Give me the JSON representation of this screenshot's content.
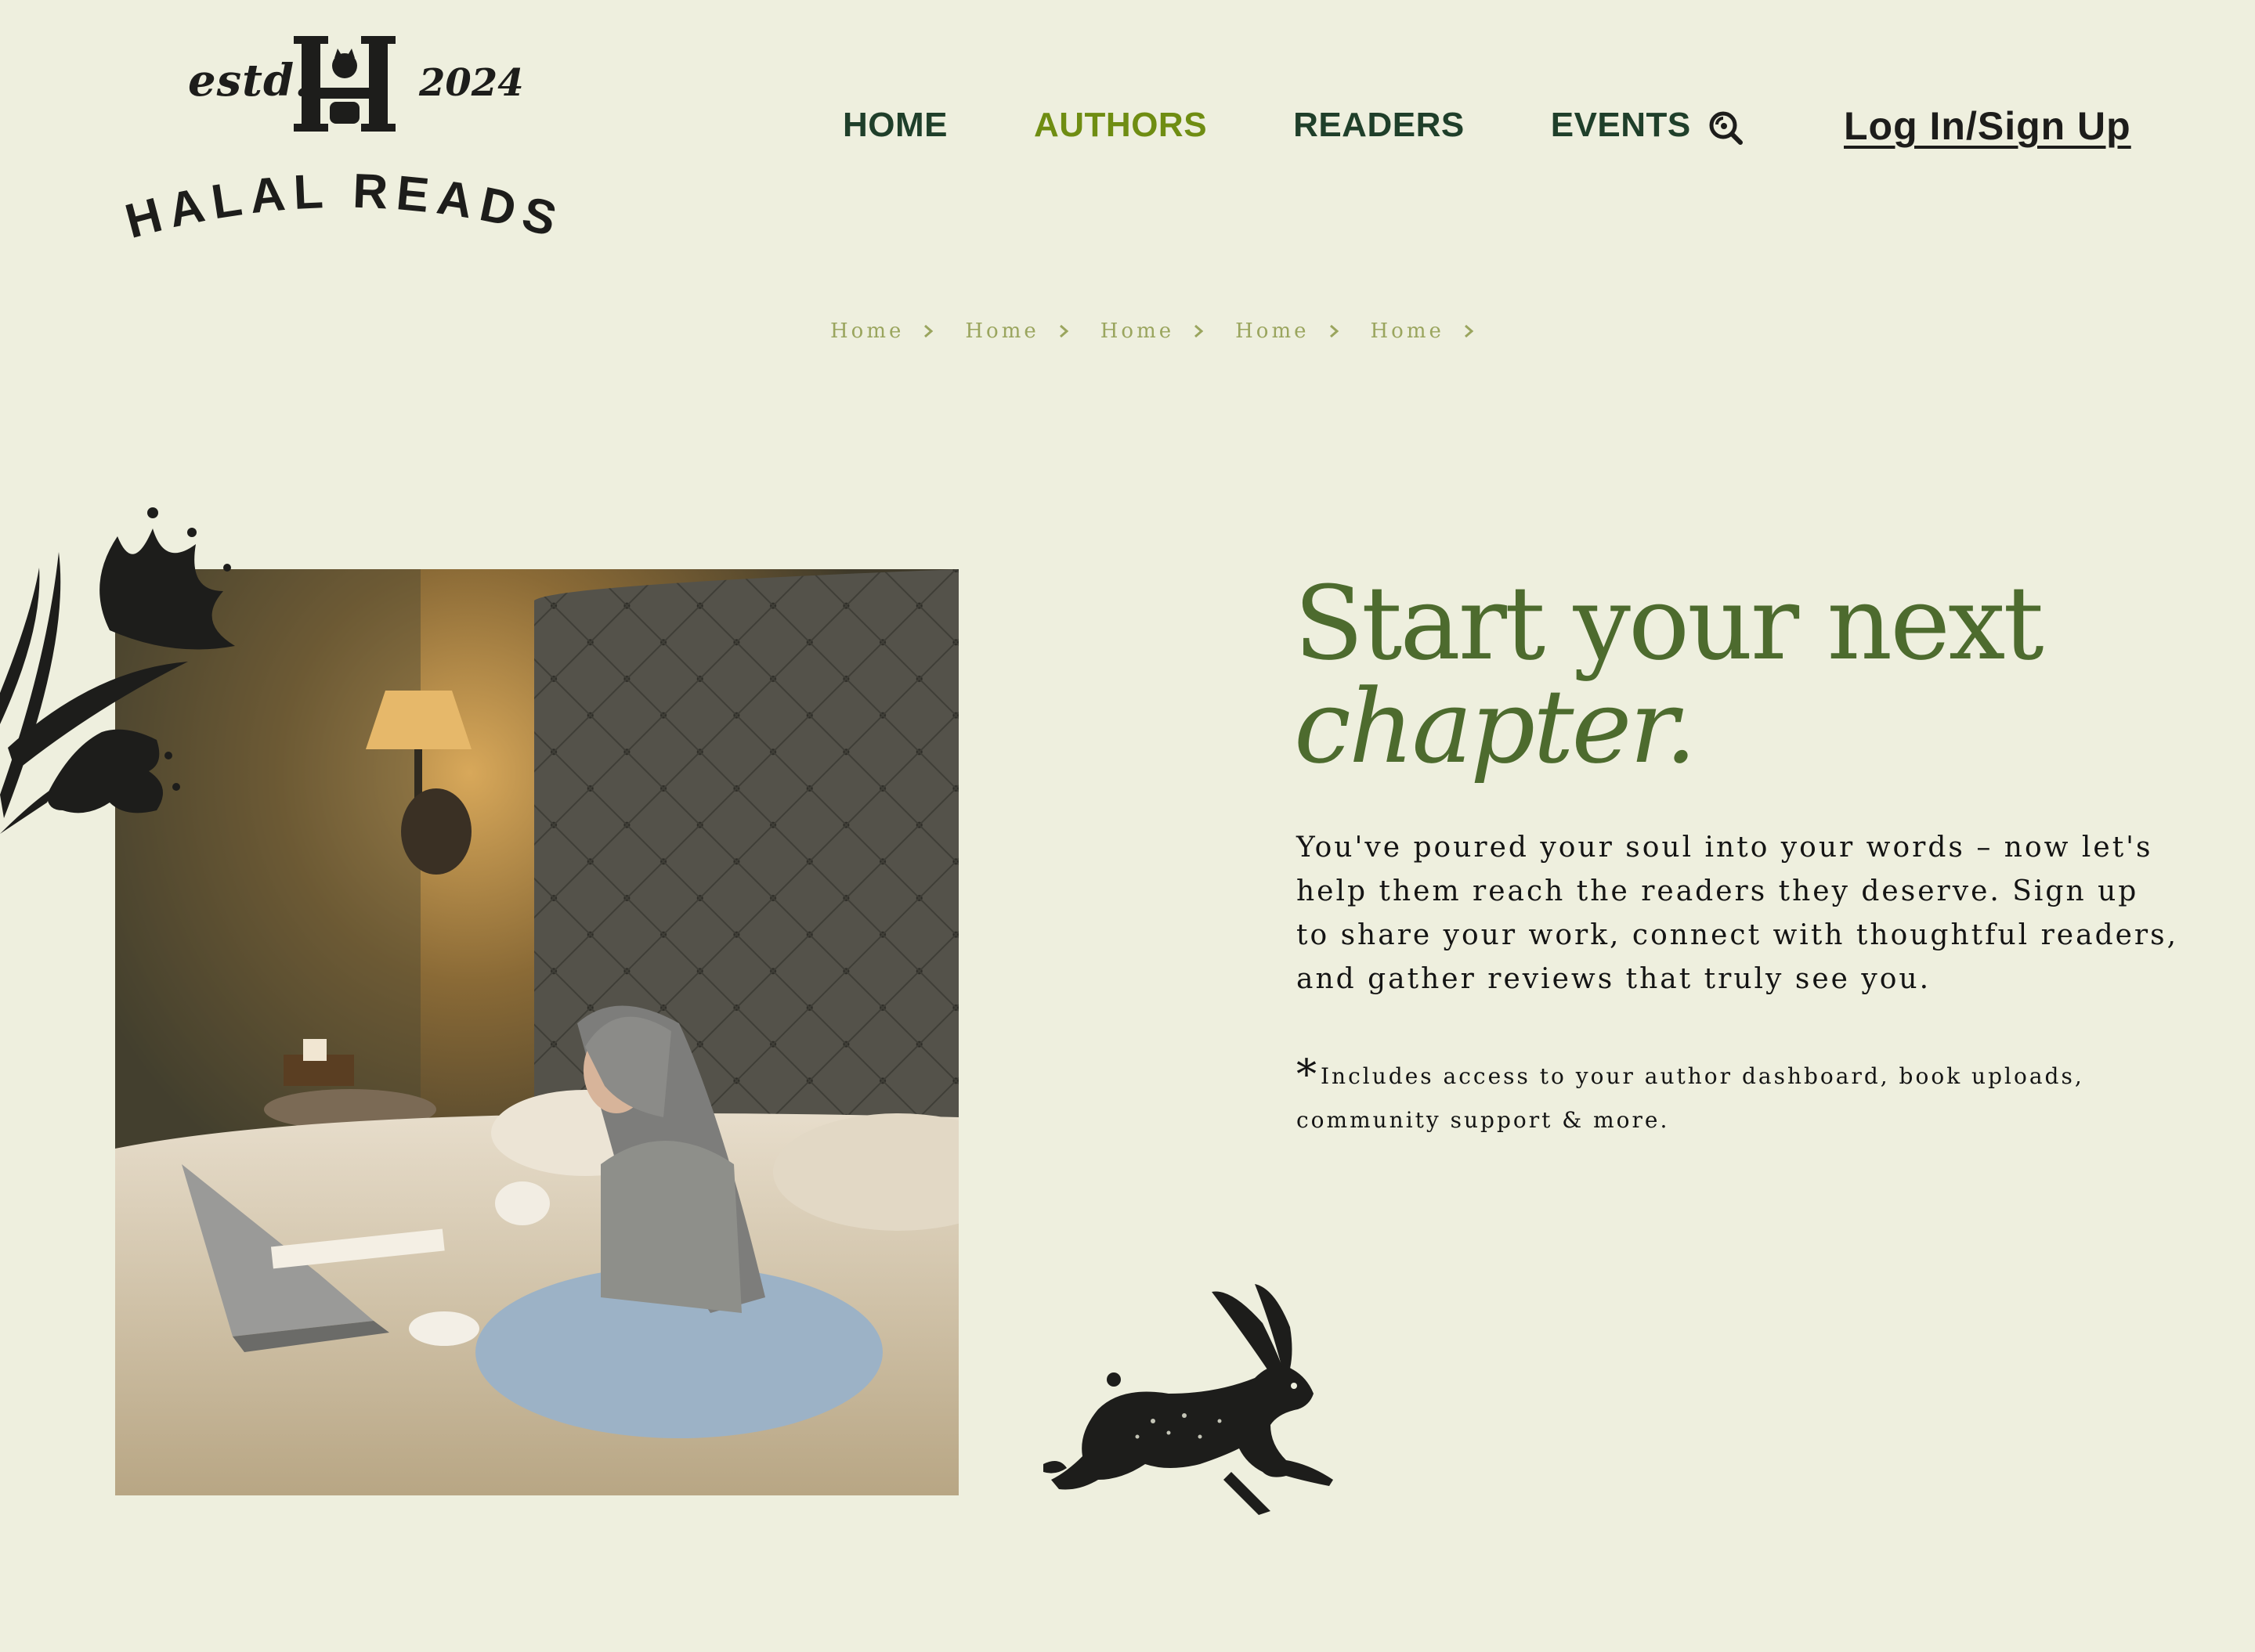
{
  "brand": {
    "estd": "estd.",
    "year": "2024",
    "monogram": "H",
    "wordmark": "HALAL READS"
  },
  "nav": {
    "items": [
      {
        "label": "HOME",
        "active": false
      },
      {
        "label": "AUTHORS",
        "active": true
      },
      {
        "label": "READERS",
        "active": false
      },
      {
        "label": "EVENTS",
        "active": false
      }
    ],
    "search_icon": "search-icon",
    "login_label": "Log In/Sign Up"
  },
  "breadcrumb": {
    "items": [
      "Home",
      "Home",
      "Home",
      "Home",
      "Home"
    ]
  },
  "hero": {
    "headline_line1": "Start your next",
    "headline_line2": "chapter.",
    "body": "You've poured your soul into your words – now let's help them reach the readers they deserve. Sign up to share your work, connect with thoughtful readers, and gather reviews that truly see you.",
    "note_star": "*",
    "note": "Includes access to your author dashboard, book uploads, community support & more."
  },
  "colors": {
    "background": "#eeefde",
    "nav_text": "#1f3f2a",
    "nav_active": "#6f8d12",
    "headline": "#4d6b2e",
    "breadcrumb": "#9aa55e",
    "ink": "#1d1d1b"
  },
  "decorations": {
    "flower_icon": "flower-illustration",
    "hare_icon": "hare-illustration"
  }
}
